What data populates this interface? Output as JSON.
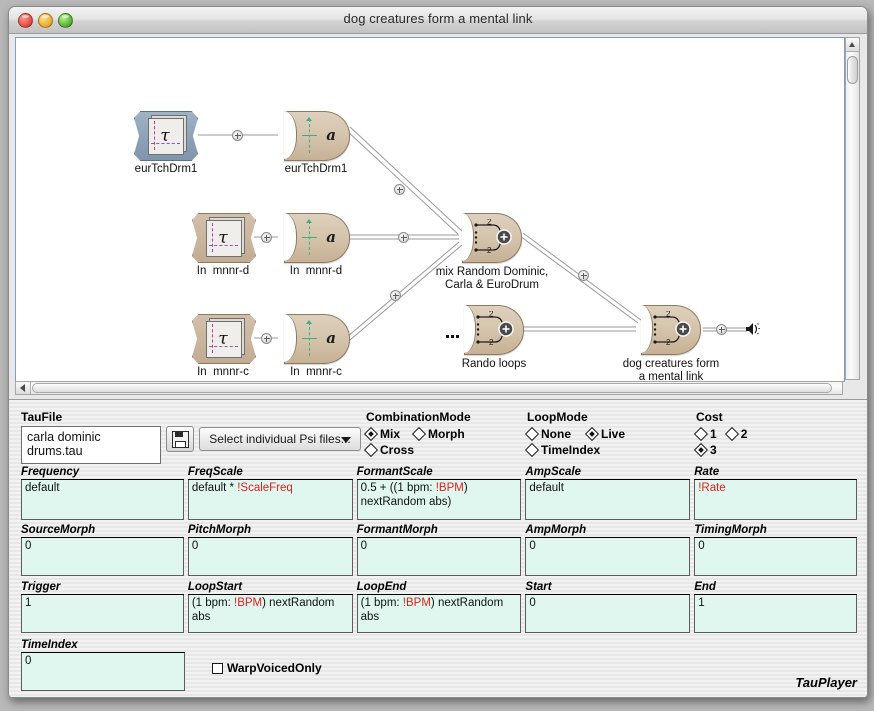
{
  "window": {
    "title": "dog creatures form a mental link",
    "controls": {
      "close": "close",
      "minimize": "minimize",
      "zoom": "zoom"
    }
  },
  "graph": {
    "nodes": [
      {
        "id": "src-eur",
        "label": "eurTchDrm1",
        "type": "tau-source",
        "selected": true
      },
      {
        "id": "psi-eur",
        "label": "eurTchDrm1",
        "type": "psi-a"
      },
      {
        "id": "src-mnnrd",
        "label": "In  mnnr-d",
        "type": "tau-source",
        "selected": false
      },
      {
        "id": "psi-mnnrd",
        "label": "In  mnnr-d",
        "type": "psi-a"
      },
      {
        "id": "src-mnnrc",
        "label": "In  mnnr-c",
        "type": "tau-source",
        "selected": false
      },
      {
        "id": "psi-mnnrc",
        "label": "In  mnnr-c",
        "type": "psi-a"
      },
      {
        "id": "mix-main",
        "label": "mix Random Dominic,\nCarla & EuroDrum",
        "type": "mixer",
        "port_count": "2"
      },
      {
        "id": "rando",
        "label": "Rando loops",
        "type": "mixer",
        "port_count": "2"
      },
      {
        "id": "out-dog",
        "label": "dog creatures form\na mental link",
        "type": "mixer",
        "port_count": "2"
      }
    ],
    "output_icon": "speaker-icon"
  },
  "taufile": {
    "label": "TauFile",
    "value": "carla dominic drums.tau",
    "save_icon": "floppy-disk-icon",
    "dropdown_value": "Select individual Psi files...",
    "dropdown_icon": "chevron-down-icon"
  },
  "combination_mode": {
    "label": "CombinationMode",
    "options": [
      {
        "label": "Mix",
        "selected": true
      },
      {
        "label": "Morph",
        "selected": false
      },
      {
        "label": "Cross",
        "selected": false
      }
    ]
  },
  "loop_mode": {
    "label": "LoopMode",
    "options": [
      {
        "label": "None",
        "selected": false
      },
      {
        "label": "Live",
        "selected": true
      },
      {
        "label": "TimeIndex",
        "selected": false
      }
    ]
  },
  "cost": {
    "label": "Cost",
    "options": [
      {
        "label": "1",
        "selected": false
      },
      {
        "label": "2",
        "selected": false
      },
      {
        "label": "3",
        "selected": true
      }
    ]
  },
  "params": {
    "row1": [
      {
        "label": "Frequency",
        "value": "default"
      },
      {
        "label": "FreqScale",
        "value": "default * ",
        "highlight": "!ScaleFreq",
        "tail": ""
      },
      {
        "label": "FormantScale",
        "value": "0.5 + ((1 bpm: ",
        "highlight": "!BPM",
        "tail": ") nextRandom abs)"
      },
      {
        "label": "AmpScale",
        "value": "default"
      },
      {
        "label": "Rate",
        "value": "",
        "highlight": "!Rate",
        "tail": ""
      }
    ],
    "row2": [
      {
        "label": "SourceMorph",
        "value": "0"
      },
      {
        "label": "PitchMorph",
        "value": "0"
      },
      {
        "label": "FormantMorph",
        "value": "0"
      },
      {
        "label": "AmpMorph",
        "value": "0"
      },
      {
        "label": "TimingMorph",
        "value": "0"
      }
    ],
    "row3": [
      {
        "label": "Trigger",
        "value": "1"
      },
      {
        "label": "LoopStart",
        "value": "(1 bpm: ",
        "highlight": "!BPM",
        "tail": ") nextRandom abs"
      },
      {
        "label": "LoopEnd",
        "value": "(1 bpm: ",
        "highlight": "!BPM",
        "tail": ") nextRandom abs"
      },
      {
        "label": "Start",
        "value": "0"
      },
      {
        "label": "End",
        "value": "1"
      }
    ],
    "row4": [
      {
        "label": "TimeIndex",
        "value": "0"
      }
    ]
  },
  "warp": {
    "label": "WarpVoicedOnly",
    "checked": false
  },
  "brand": "TauPlayer",
  "colors": {
    "field_bg": "#dff7ee",
    "highlight": "#e02020",
    "node_tan": "#d6c5ae",
    "node_selected": "#8e a5 bb",
    "canvas_border": "#7f9fc4"
  }
}
